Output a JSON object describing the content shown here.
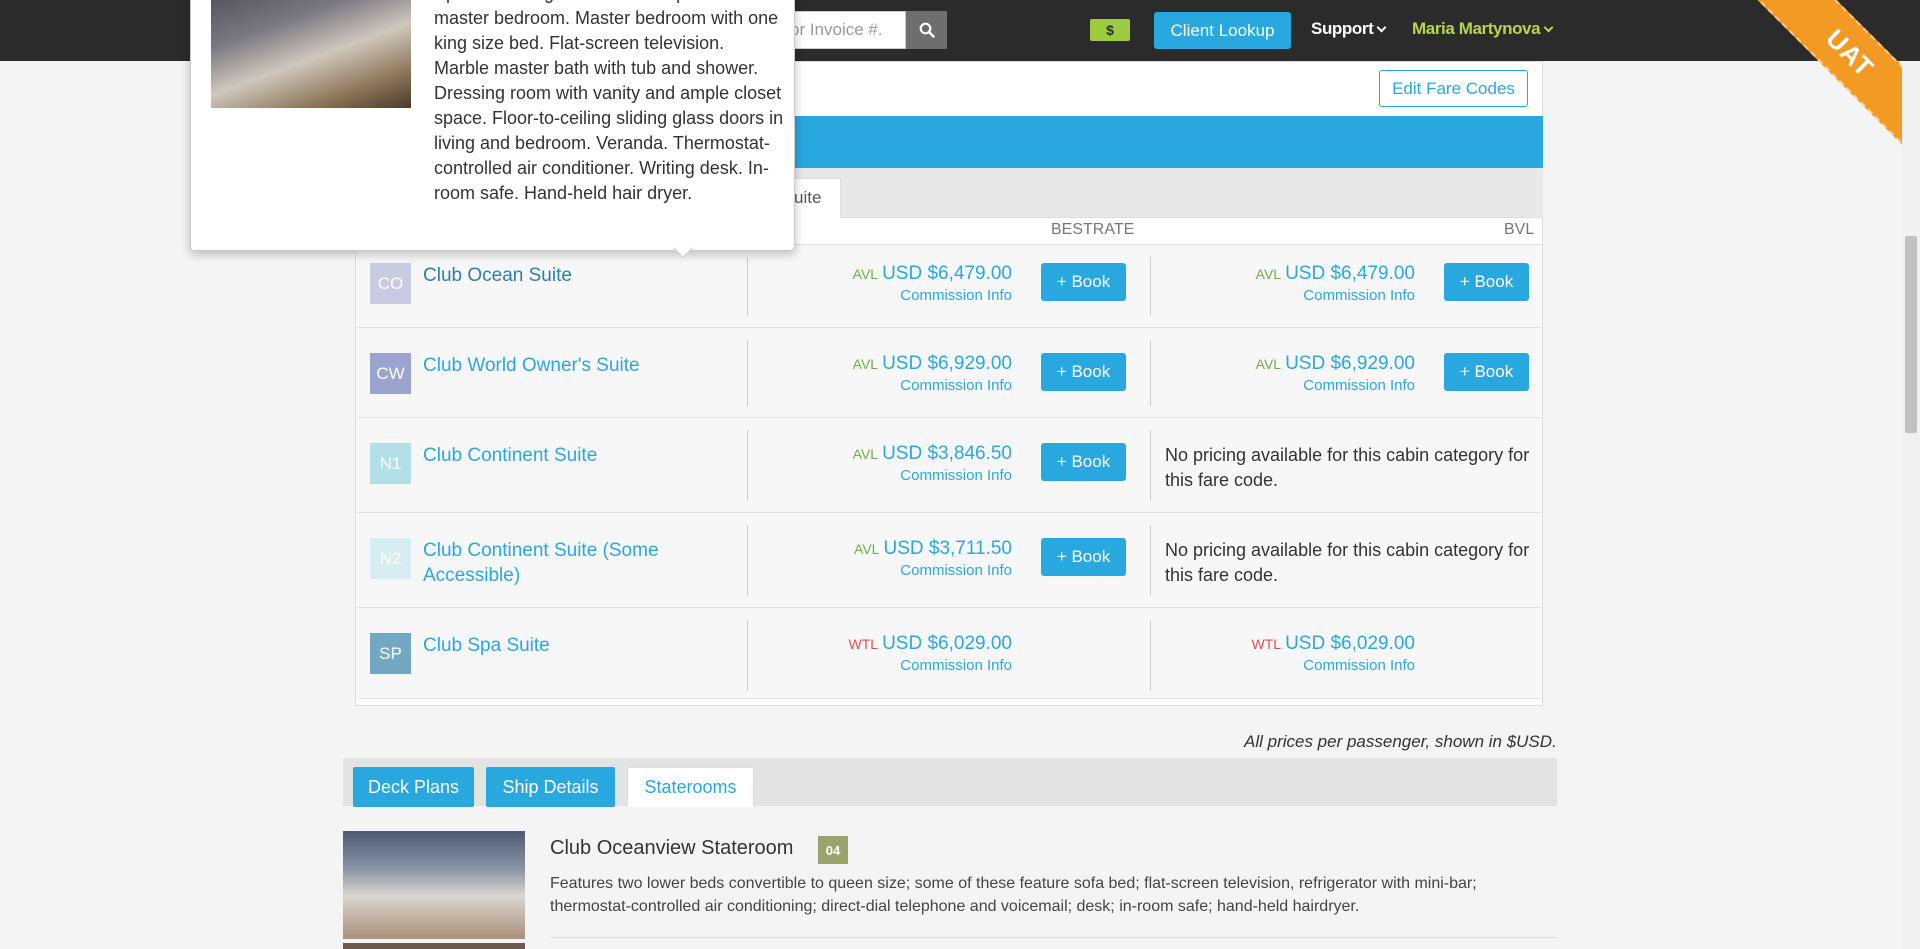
{
  "nav": {
    "search_placeholder": "or Invoice #.",
    "money_badge": "$",
    "client_lookup": "Client Lookup",
    "support": "Support",
    "user": "Maria Martynova"
  },
  "ribbon": "UAT",
  "panel": {
    "edit_fare_codes": "Edit Fare Codes",
    "tab_partial": "uite",
    "col_bestrate": "BESTRATE",
    "col_bvl": "BVL"
  },
  "popover": {
    "text": "Spacious living room with a separate master bedroom. Master bedroom with one king size bed. Flat-screen television. Marble master bath with tub and shower. Dressing room with vanity and ample closet space. Floor-to-ceiling sliding glass doors in living and bedroom. Veranda. Thermostat-controlled air conditioner. Writing desk. In-room safe. Hand-held hair dryer."
  },
  "cabins": [
    {
      "code": "CO",
      "code_color": "#c9cbe3",
      "name": "Club Ocean Suite",
      "bestrate": {
        "status": "AVL",
        "price": "USD $6,479.00",
        "commission": "Commission Info",
        "book": "+ Book"
      },
      "bvl": {
        "status": "AVL",
        "price": "USD $6,479.00",
        "commission": "Commission Info",
        "book": "+ Book"
      }
    },
    {
      "code": "CW",
      "code_color": "#9aa4cf",
      "name": "Club World Owner's Suite",
      "bestrate": {
        "status": "AVL",
        "price": "USD $6,929.00",
        "commission": "Commission Info",
        "book": "+ Book"
      },
      "bvl": {
        "status": "AVL",
        "price": "USD $6,929.00",
        "commission": "Commission Info",
        "book": "+ Book"
      }
    },
    {
      "code": "N1",
      "code_color": "#b3e0e6",
      "name": "Club Continent Suite",
      "bestrate": {
        "status": "AVL",
        "price": "USD $3,846.50",
        "commission": "Commission Info",
        "book": "+ Book"
      },
      "bvl_note": "No pricing available for this cabin category for this fare code."
    },
    {
      "code": "N2",
      "code_color": "#d6eef2",
      "name": "Club Continent Suite (Some Accessible)",
      "bestrate": {
        "status": "AVL",
        "price": "USD $3,711.50",
        "commission": "Commission Info",
        "book": "+ Book"
      },
      "bvl_note": "No pricing available for this cabin category for this fare code."
    },
    {
      "code": "SP",
      "code_color": "#73a8c4",
      "name": "Club Spa Suite",
      "bestrate": {
        "status": "WTL",
        "price": "USD $6,029.00",
        "commission": "Commission Info"
      },
      "bvl": {
        "status": "WTL",
        "price": "USD $6,029.00",
        "commission": "Commission Info"
      }
    }
  ],
  "prices_note": "All prices per passenger, shown in $USD.",
  "bottom_tabs": [
    "Deck Plans",
    "Ship Details",
    "Staterooms"
  ],
  "stateroom": {
    "title": "Club Oceanview Stateroom",
    "deck": "04",
    "description": "Features two lower beds convertible to queen size; some of these feature sofa bed; flat-screen television, refrigerator with mini-bar; thermostat-controlled air conditioning; direct-dial telephone and voicemail; desk; in-room safe; hand-held hairdryer."
  },
  "colors": {
    "accent": "#29a8e0",
    "available": "#6bb142",
    "waitlist": "#e05050",
    "ribbon": "#f39a25"
  }
}
